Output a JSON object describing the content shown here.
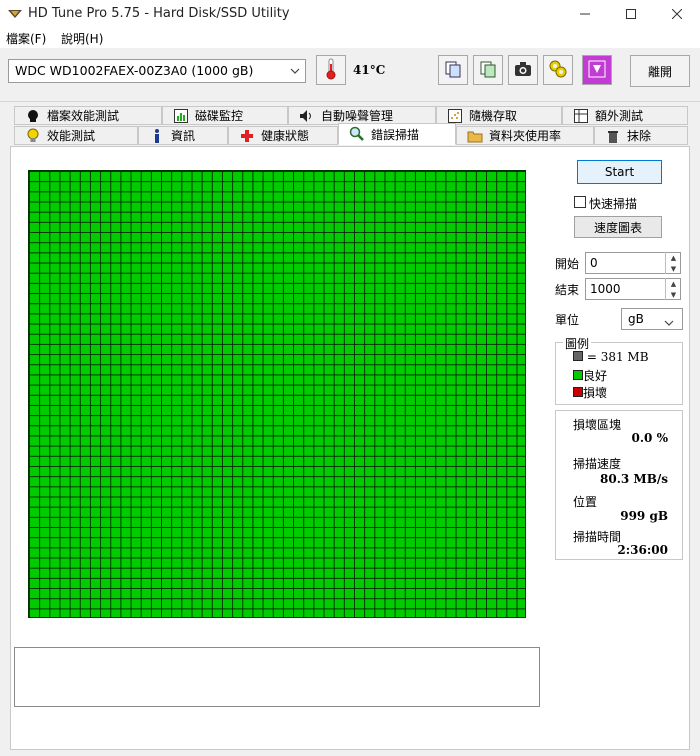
{
  "window": {
    "title": "HD Tune Pro 5.75 - Hard Disk/SSD Utility",
    "controls": [
      "minimize-icon",
      "maximize-icon",
      "close-icon"
    ]
  },
  "menu": {
    "items": [
      "檔案(F)",
      "說明(H)"
    ]
  },
  "toolbar": {
    "drive": "WDC WD1002FAEX-00Z3A0 (1000 gB)",
    "temperature": "41°C",
    "buttons": [
      "copy-icon",
      "compare-icon",
      "camera-icon",
      "options-icon",
      "download-icon"
    ],
    "exit_label": "離開"
  },
  "tabs": {
    "row1": [
      "檔案效能測試",
      "磁碟監控",
      "自動噪聲管理",
      "隨機存取",
      "額外測試"
    ],
    "row2": [
      "效能測試",
      "資訊",
      "健康狀態",
      "錯誤掃描",
      "資料夾使用率",
      "抹除"
    ],
    "active": "錯誤掃描"
  },
  "controls": {
    "start_label": "Start",
    "quick_scan_label": "快速掃描",
    "quick_scan_checked": false,
    "speed_map_label": "速度圖表",
    "start_label_text": "開始",
    "start_value": "0",
    "end_label_text": "結束",
    "end_value": "1000",
    "unit_label": "單位",
    "unit_value": "gB"
  },
  "legend": {
    "title": "圖例",
    "block_size": "= 381 MB",
    "good": "良好",
    "damaged": "損壞",
    "colors": {
      "block": "#666666",
      "good": "#00cc00",
      "damaged": "#cc0000"
    }
  },
  "stats": {
    "damaged_blocks_label": "損壞區塊",
    "damaged_blocks_value": "0.0 %",
    "scan_speed_label": "掃描速度",
    "scan_speed_value": "80.3 MB/s",
    "position_label": "位置",
    "position_value": "999 gB",
    "scan_time_label": "掃描時間",
    "scan_time_value": "2:36:00"
  },
  "scan_grid": {
    "status": "all-good",
    "color": "#00cc00"
  }
}
